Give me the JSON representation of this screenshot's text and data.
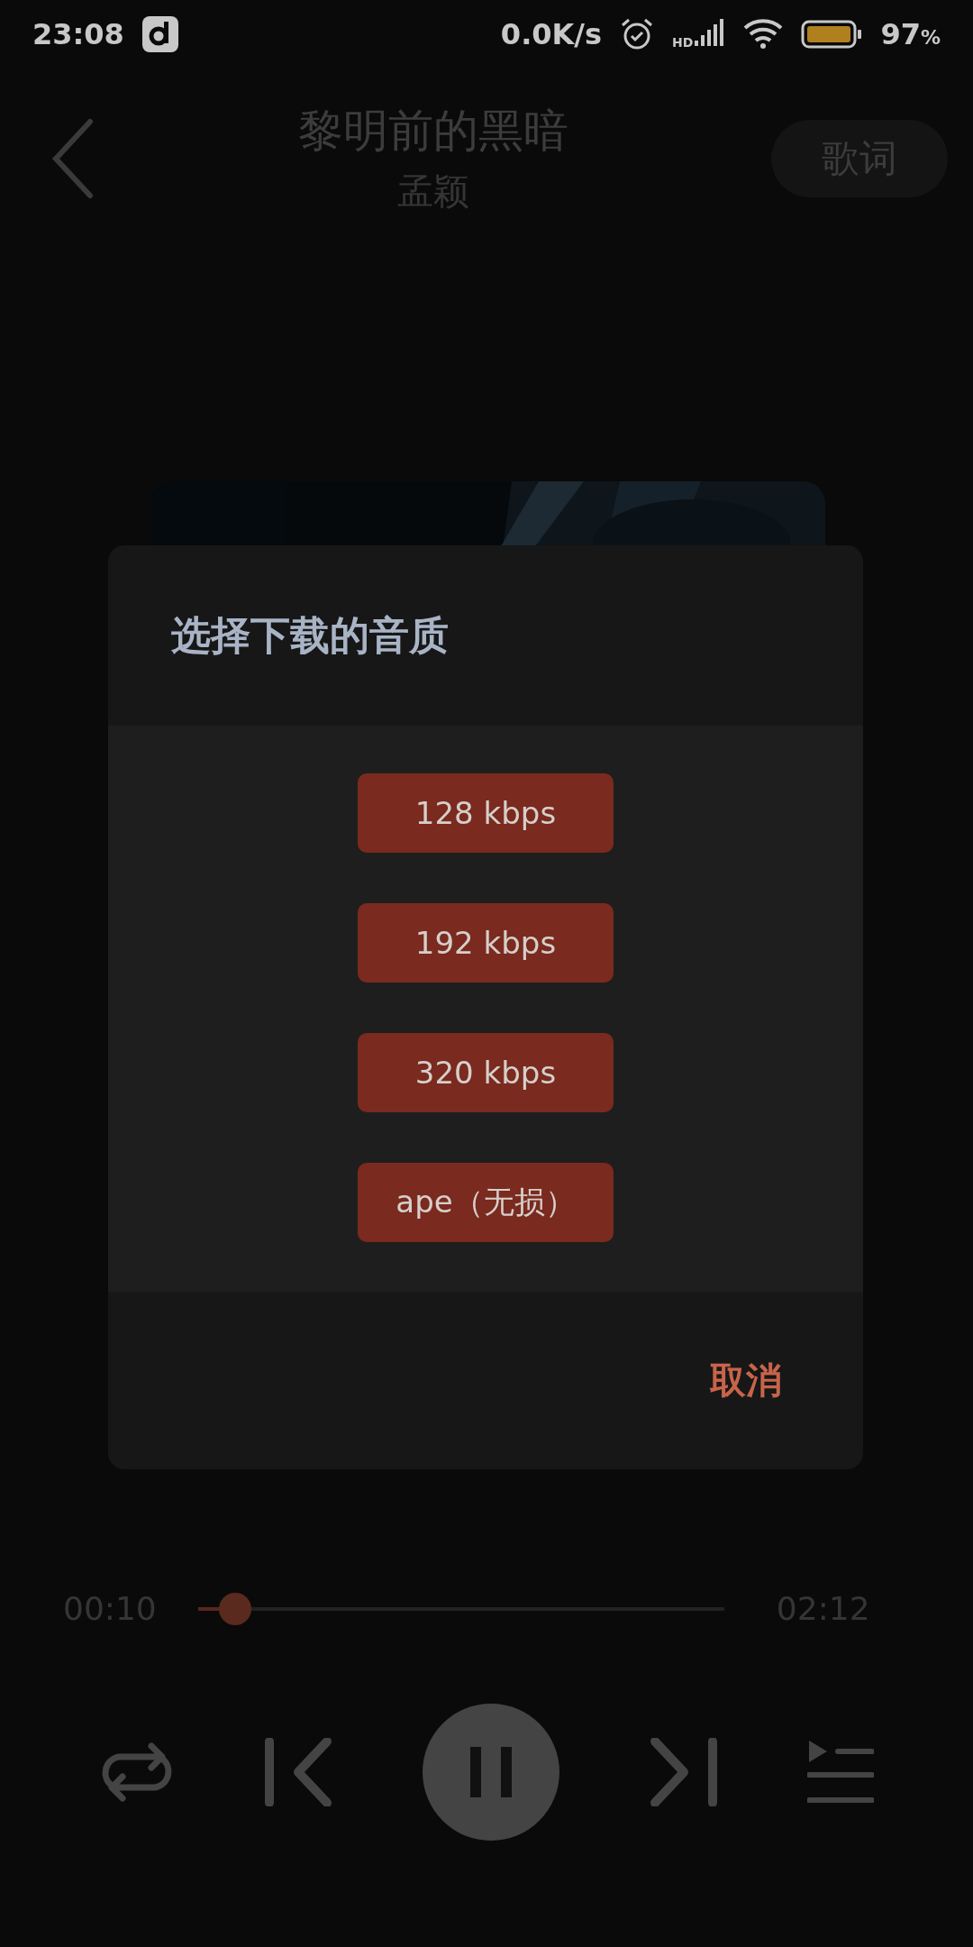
{
  "status_bar": {
    "time": "23:08",
    "speed": "0.0K/s",
    "network": "HD",
    "battery_percent": "97",
    "battery_unit": "%"
  },
  "header": {
    "title": "黎明前的黑暗",
    "artist": "孟颖",
    "lyrics_button": "歌词"
  },
  "dialog": {
    "title": "选择下载的音质",
    "options": [
      {
        "label": "128 kbps"
      },
      {
        "label": "192 kbps"
      },
      {
        "label": "320 kbps"
      },
      {
        "label": "ape（无损）"
      }
    ],
    "cancel": "取消"
  },
  "progress": {
    "elapsed": "00:10",
    "total": "02:12",
    "level": 0.07
  },
  "controls": {
    "playing": true
  }
}
